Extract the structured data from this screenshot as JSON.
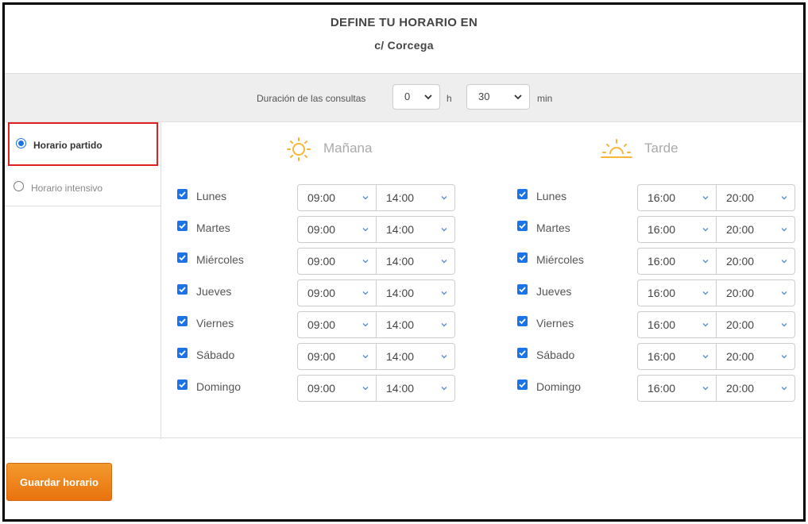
{
  "header": {
    "title": "DEFINE TU HORARIO EN",
    "address": "c/ Corcega"
  },
  "duration": {
    "label": "Duración de las consultas",
    "hours_value": "0",
    "hours_unit": "h",
    "minutes_value": "30",
    "minutes_unit": "min"
  },
  "schedule_type": {
    "options": [
      {
        "label": "Horario partido",
        "selected": true
      },
      {
        "label": "Horario intensivo",
        "selected": false
      }
    ]
  },
  "morning": {
    "title": "Mañana",
    "icon": "sun-icon",
    "rows": [
      {
        "day": "Lunes",
        "checked": true,
        "start": "09:00",
        "end": "14:00"
      },
      {
        "day": "Martes",
        "checked": true,
        "start": "09:00",
        "end": "14:00"
      },
      {
        "day": "Miércoles",
        "checked": true,
        "start": "09:00",
        "end": "14:00"
      },
      {
        "day": "Jueves",
        "checked": true,
        "start": "09:00",
        "end": "14:00"
      },
      {
        "day": "Viernes",
        "checked": true,
        "start": "09:00",
        "end": "14:00"
      },
      {
        "day": "Sábado",
        "checked": true,
        "start": "09:00",
        "end": "14:00"
      },
      {
        "day": "Domingo",
        "checked": true,
        "start": "09:00",
        "end": "14:00"
      }
    ]
  },
  "afternoon": {
    "title": "Tarde",
    "icon": "sunset-icon",
    "rows": [
      {
        "day": "Lunes",
        "checked": true,
        "start": "16:00",
        "end": "20:00"
      },
      {
        "day": "Martes",
        "checked": true,
        "start": "16:00",
        "end": "20:00"
      },
      {
        "day": "Miércoles",
        "checked": true,
        "start": "16:00",
        "end": "20:00"
      },
      {
        "day": "Jueves",
        "checked": true,
        "start": "16:00",
        "end": "20:00"
      },
      {
        "day": "Viernes",
        "checked": true,
        "start": "16:00",
        "end": "20:00"
      },
      {
        "day": "Sábado",
        "checked": true,
        "start": "16:00",
        "end": "20:00"
      },
      {
        "day": "Domingo",
        "checked": true,
        "start": "16:00",
        "end": "20:00"
      }
    ]
  },
  "actions": {
    "save_label": "Guardar horario"
  },
  "colors": {
    "accent": "#1a73e8",
    "sun": "#f5b63a",
    "button": "#f08a1c",
    "highlight_box": "#e02020"
  }
}
